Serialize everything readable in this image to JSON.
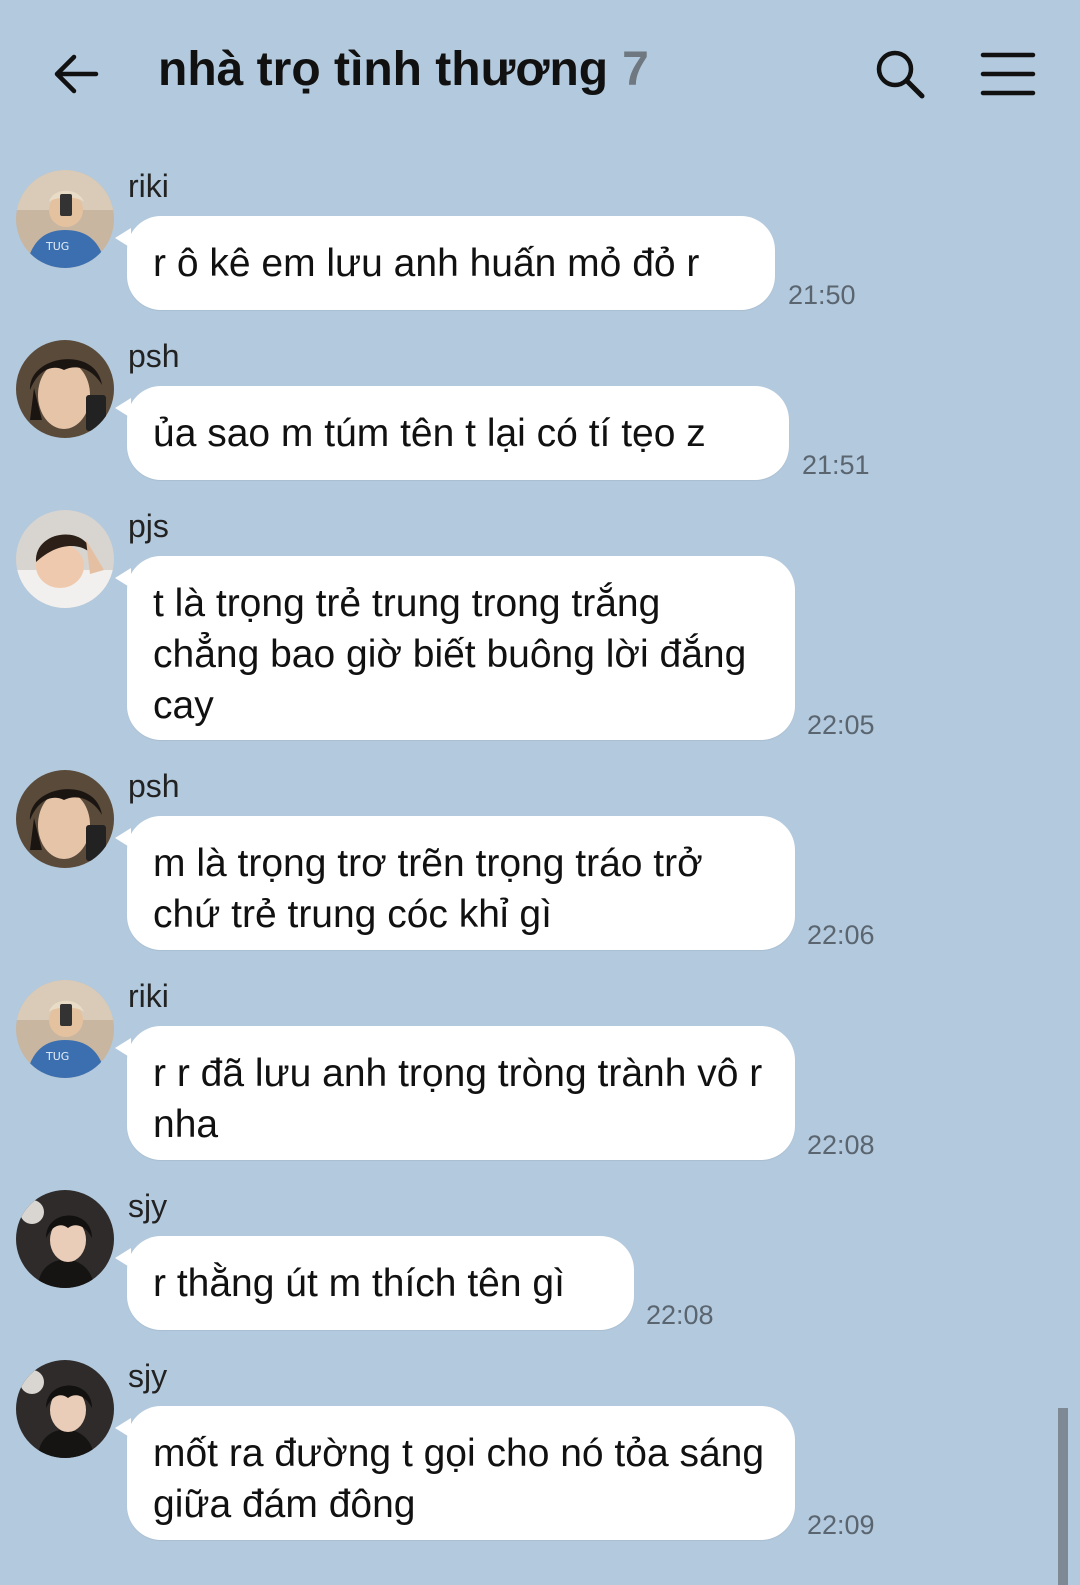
{
  "header": {
    "title": "nhà trọ tình thương",
    "member_count": "7",
    "back_icon": "arrow-left-icon",
    "search_icon": "search-icon",
    "menu_icon": "hamburger-menu-icon"
  },
  "messages": [
    {
      "sender": "riki",
      "avatar": "avatar-riki",
      "text": "r ô kê em lưu anh huấn mỏ đỏ r",
      "time": "21:50"
    },
    {
      "sender": "psh",
      "avatar": "avatar-psh",
      "text": "ủa sao m túm tên t lại có tí tẹo z",
      "time": "21:51"
    },
    {
      "sender": "pjs",
      "avatar": "avatar-pjs",
      "text": "t là trọng trẻ trung trong trắng chẳng bao giờ biết buông lời đắng cay",
      "time": "22:05"
    },
    {
      "sender": "psh",
      "avatar": "avatar-psh",
      "text": "m là trọng trơ trẽn trọng tráo trở chứ trẻ trung cóc khỉ gì",
      "time": "22:06"
    },
    {
      "sender": "riki",
      "avatar": "avatar-riki",
      "text": "r r đã lưu anh trọng tròng trành vô r nha",
      "time": "22:08"
    },
    {
      "sender": "sjy",
      "avatar": "avatar-sjy",
      "text": "r thằng út m thích tên gì",
      "time": "22:08"
    },
    {
      "sender": "sjy",
      "avatar": "avatar-sjy",
      "text": "mốt ra đường t gọi cho nó tỏa sáng giữa đám đông",
      "time": "22:09"
    }
  ]
}
